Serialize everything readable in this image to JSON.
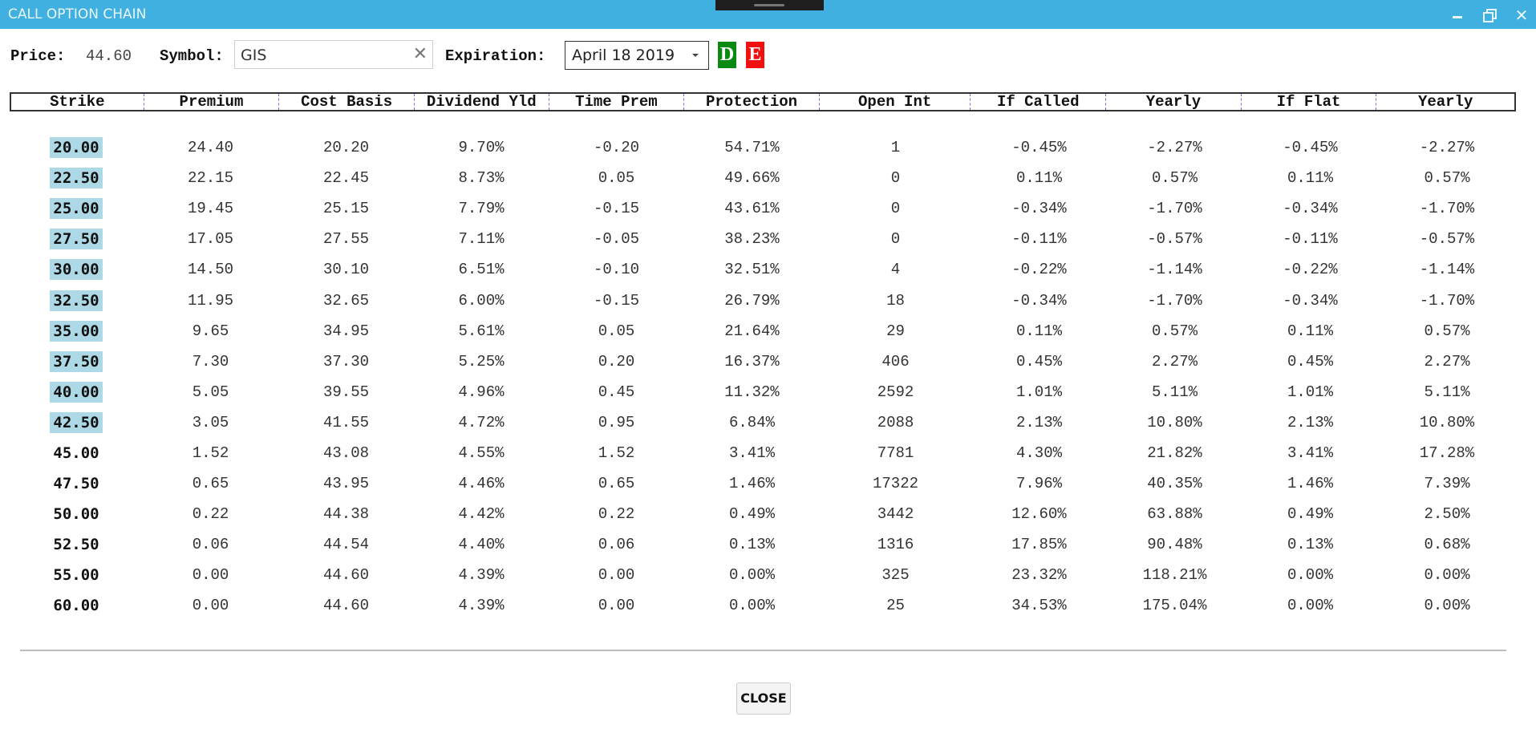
{
  "window": {
    "title": "CALL OPTION CHAIN",
    "controls": {
      "minimize": "minimize",
      "restore": "restore",
      "close": "✕"
    }
  },
  "toolbar": {
    "price_label": "Price:",
    "price_value": "44.60",
    "symbol_label": "Symbol:",
    "symbol_value": "GIS",
    "symbol_clear": "✕",
    "expiration_label": "Expiration:",
    "expiration_value": "April 18 2019",
    "d_button": "D",
    "e_button": "E",
    "colors": {
      "d_button": "#0a8a12",
      "e_button": "#f01010",
      "title_bar": "#3fb0e0",
      "itm_highlight": "#add8e6"
    }
  },
  "table": {
    "headers": [
      "Strike",
      "Premium",
      "Cost Basis",
      "Dividend Yld",
      "Time Prem",
      "Protection",
      "Open Int",
      "If Called",
      "Yearly",
      "If Flat",
      "Yearly"
    ],
    "rows": [
      {
        "itm": true,
        "cells": [
          "20.00",
          "24.40",
          "20.20",
          "9.70%",
          "-0.20",
          "54.71%",
          "1",
          "-0.45%",
          "-2.27%",
          "-0.45%",
          "-2.27%"
        ]
      },
      {
        "itm": true,
        "cells": [
          "22.50",
          "22.15",
          "22.45",
          "8.73%",
          "0.05",
          "49.66%",
          "0",
          "0.11%",
          "0.57%",
          "0.11%",
          "0.57%"
        ]
      },
      {
        "itm": true,
        "cells": [
          "25.00",
          "19.45",
          "25.15",
          "7.79%",
          "-0.15",
          "43.61%",
          "0",
          "-0.34%",
          "-1.70%",
          "-0.34%",
          "-1.70%"
        ]
      },
      {
        "itm": true,
        "cells": [
          "27.50",
          "17.05",
          "27.55",
          "7.11%",
          "-0.05",
          "38.23%",
          "0",
          "-0.11%",
          "-0.57%",
          "-0.11%",
          "-0.57%"
        ]
      },
      {
        "itm": true,
        "cells": [
          "30.00",
          "14.50",
          "30.10",
          "6.51%",
          "-0.10",
          "32.51%",
          "4",
          "-0.22%",
          "-1.14%",
          "-0.22%",
          "-1.14%"
        ]
      },
      {
        "itm": true,
        "cells": [
          "32.50",
          "11.95",
          "32.65",
          "6.00%",
          "-0.15",
          "26.79%",
          "18",
          "-0.34%",
          "-1.70%",
          "-0.34%",
          "-1.70%"
        ]
      },
      {
        "itm": true,
        "cells": [
          "35.00",
          "9.65",
          "34.95",
          "5.61%",
          "0.05",
          "21.64%",
          "29",
          "0.11%",
          "0.57%",
          "0.11%",
          "0.57%"
        ]
      },
      {
        "itm": true,
        "cells": [
          "37.50",
          "7.30",
          "37.30",
          "5.25%",
          "0.20",
          "16.37%",
          "406",
          "0.45%",
          "2.27%",
          "0.45%",
          "2.27%"
        ]
      },
      {
        "itm": true,
        "cells": [
          "40.00",
          "5.05",
          "39.55",
          "4.96%",
          "0.45",
          "11.32%",
          "2592",
          "1.01%",
          "5.11%",
          "1.01%",
          "5.11%"
        ]
      },
      {
        "itm": true,
        "cells": [
          "42.50",
          "3.05",
          "41.55",
          "4.72%",
          "0.95",
          "6.84%",
          "2088",
          "2.13%",
          "10.80%",
          "2.13%",
          "10.80%"
        ]
      },
      {
        "itm": false,
        "cells": [
          "45.00",
          "1.52",
          "43.08",
          "4.55%",
          "1.52",
          "3.41%",
          "7781",
          "4.30%",
          "21.82%",
          "3.41%",
          "17.28%"
        ]
      },
      {
        "itm": false,
        "cells": [
          "47.50",
          "0.65",
          "43.95",
          "4.46%",
          "0.65",
          "1.46%",
          "17322",
          "7.96%",
          "40.35%",
          "1.46%",
          "7.39%"
        ]
      },
      {
        "itm": false,
        "cells": [
          "50.00",
          "0.22",
          "44.38",
          "4.42%",
          "0.22",
          "0.49%",
          "3442",
          "12.60%",
          "63.88%",
          "0.49%",
          "2.50%"
        ]
      },
      {
        "itm": false,
        "cells": [
          "52.50",
          "0.06",
          "44.54",
          "4.40%",
          "0.06",
          "0.13%",
          "1316",
          "17.85%",
          "90.48%",
          "0.13%",
          "0.68%"
        ]
      },
      {
        "itm": false,
        "cells": [
          "55.00",
          "0.00",
          "44.60",
          "4.39%",
          "0.00",
          "0.00%",
          "325",
          "23.32%",
          "118.21%",
          "0.00%",
          "0.00%"
        ]
      },
      {
        "itm": false,
        "cells": [
          "60.00",
          "0.00",
          "44.60",
          "4.39%",
          "0.00",
          "0.00%",
          "25",
          "34.53%",
          "175.04%",
          "0.00%",
          "0.00%"
        ]
      }
    ]
  },
  "footer": {
    "close_label": "CLOSE"
  }
}
